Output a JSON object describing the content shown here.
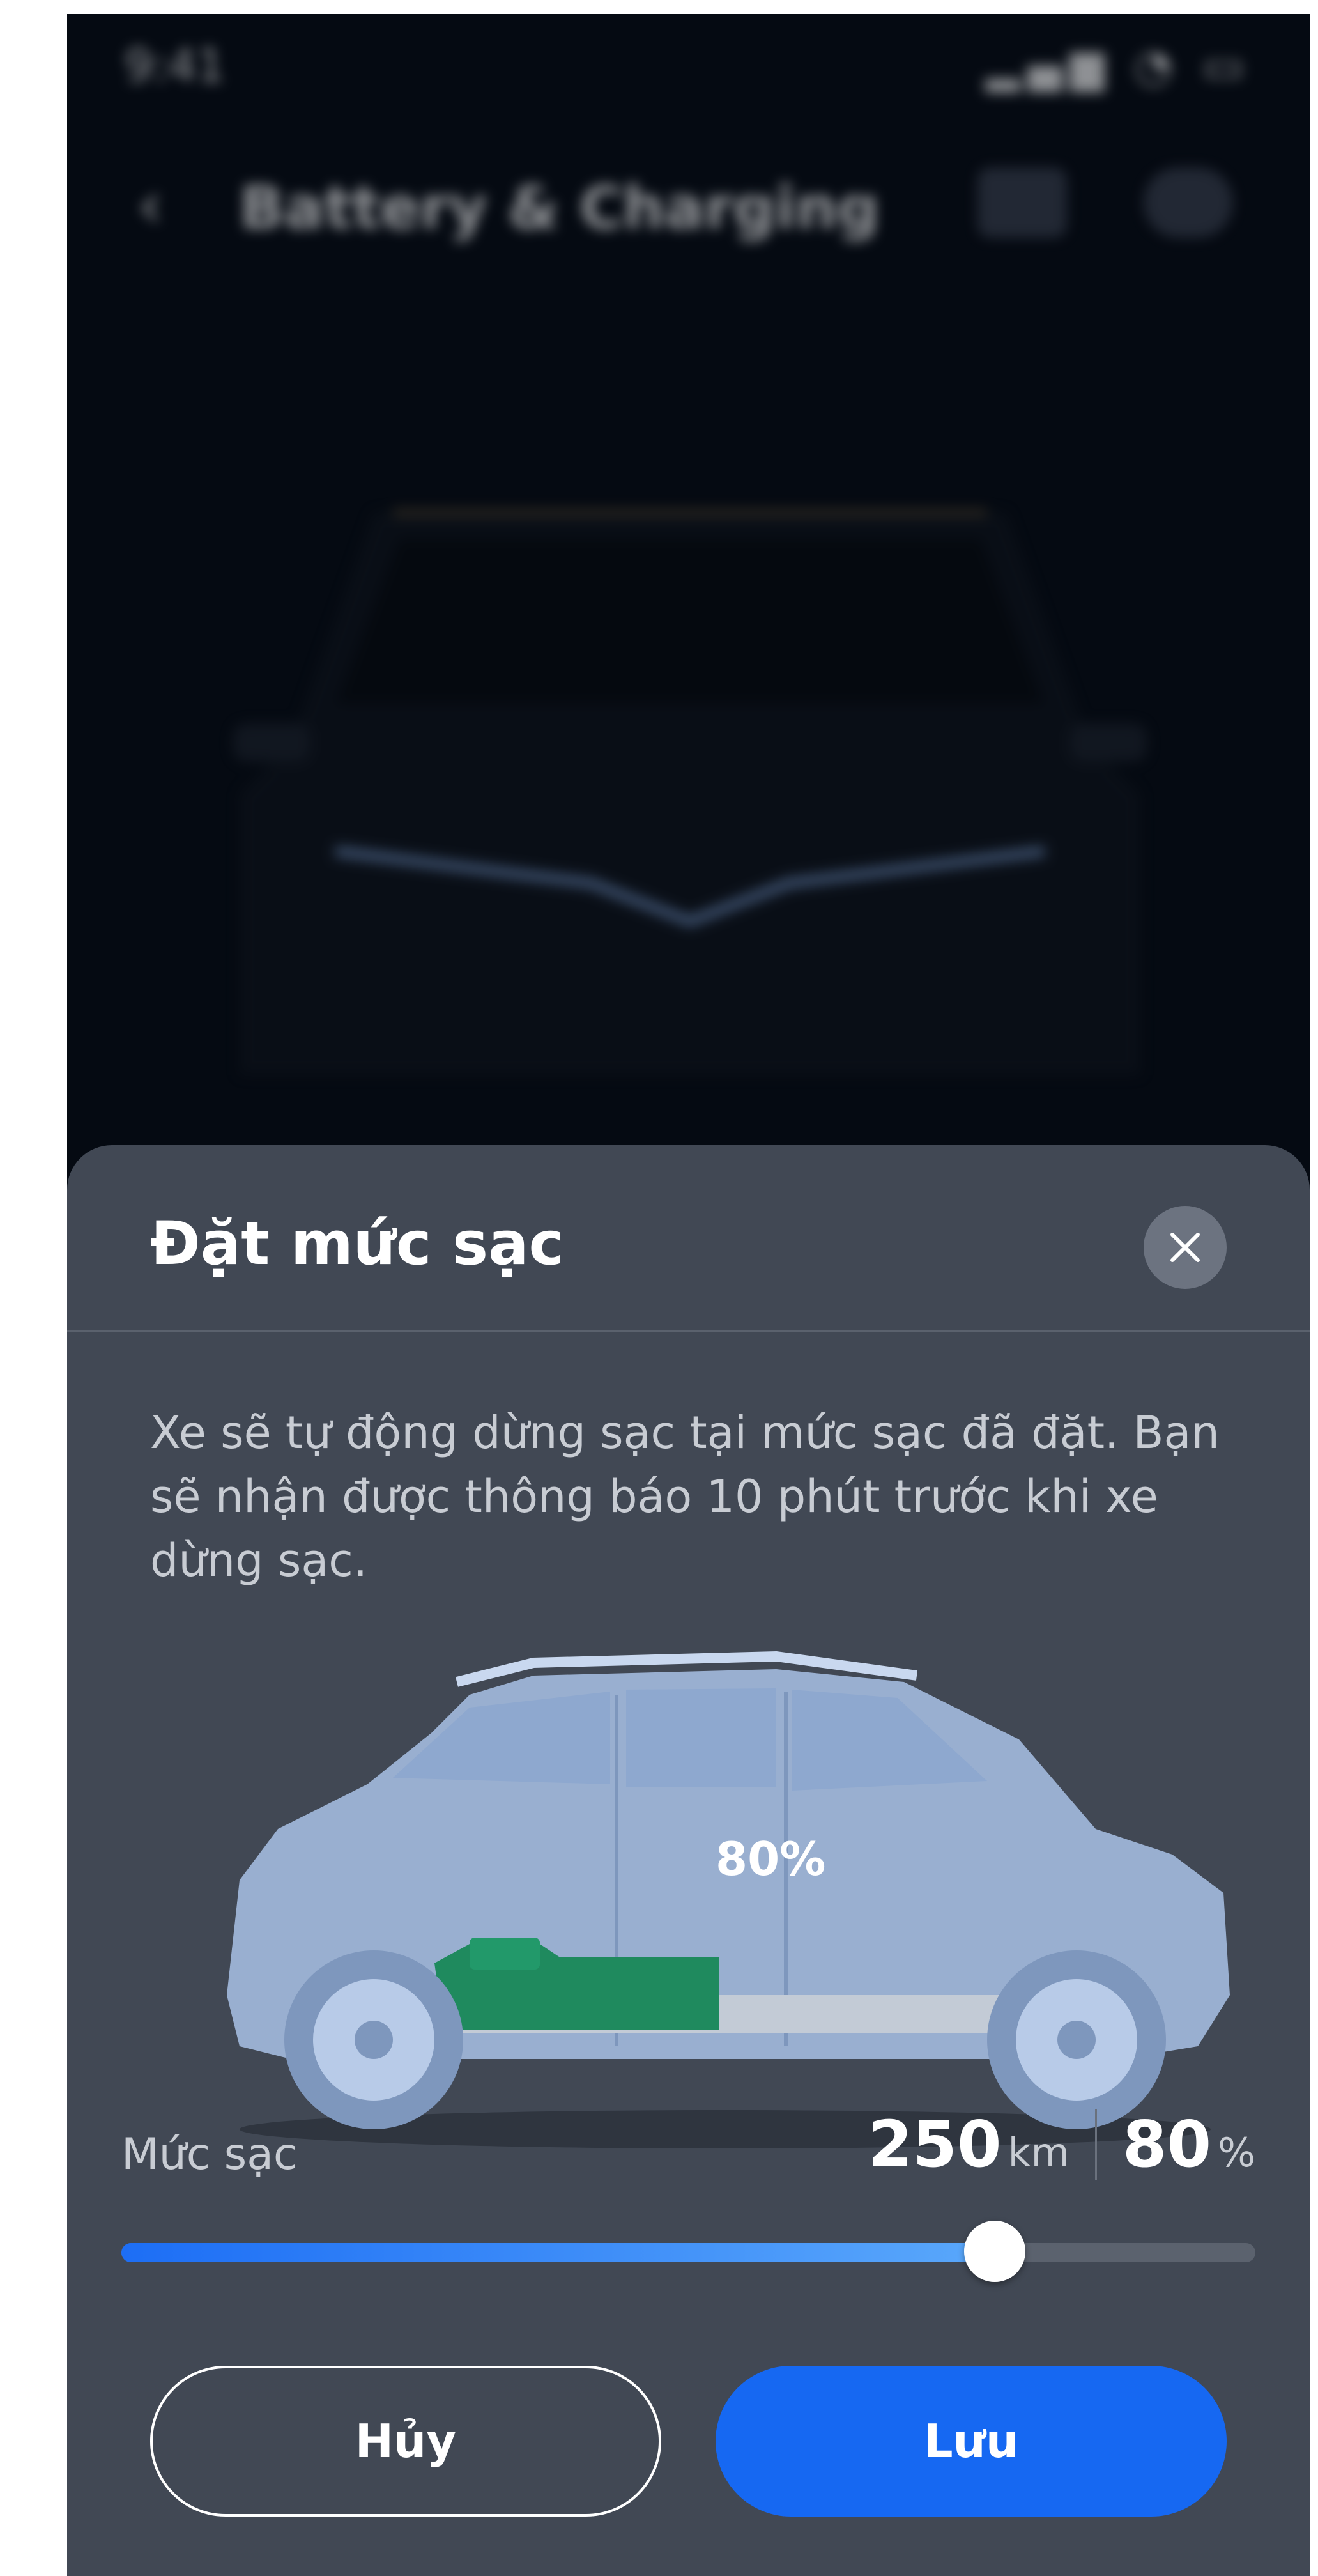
{
  "status_bar": {
    "time": "9:41",
    "icons": "▂▄▆ ◔ ▭"
  },
  "background": {
    "back_icon": "‹",
    "title": "Battery & Charging"
  },
  "sheet": {
    "title": "Đặt mức sạc",
    "description": "Xe sẽ tự động dừng sạc tại mức sạc đã đặt. Bạn sẽ nhận được thông báo 10 phút trước khi xe dừng sạc.",
    "battery_label": "80%",
    "level_label": "Mức sạc",
    "range_value": "250",
    "range_unit": "km",
    "percent_value": "80",
    "percent_unit": "%",
    "slider_fraction": 0.77,
    "cancel_label": "Hủy",
    "save_label": "Lưu"
  },
  "colors": {
    "sheet_bg": "#414854",
    "accent": "#1668f2",
    "battery_green": "#1f8a5e",
    "car_body": "#a9c2e6"
  },
  "icons": {
    "close": "close-icon",
    "back": "chevron-left-icon"
  }
}
